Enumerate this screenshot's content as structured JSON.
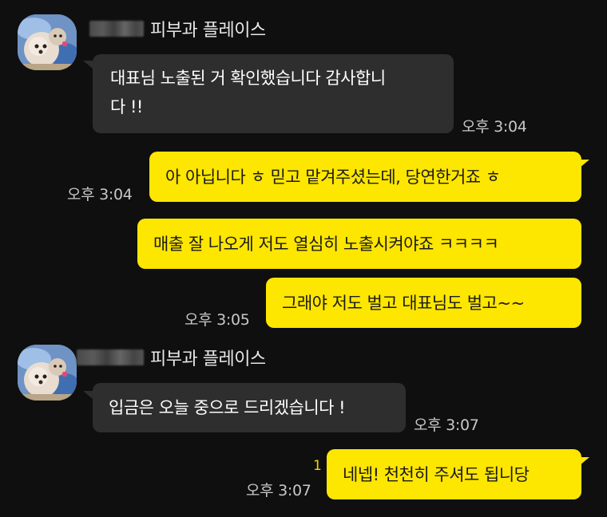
{
  "sender_name": "피부과 플레이스",
  "messages": [
    {
      "id": "m1",
      "dir": "in",
      "lines": [
        "대표님 노출된 거 확인했습니다 감사합니",
        "다 !!"
      ],
      "time": "오후 3:04"
    },
    {
      "id": "m2",
      "dir": "out",
      "text": "아 아닙니다 ㅎ 믿고 맡겨주셨는데, 당연한거죠 ㅎ",
      "time": "오후 3:04"
    },
    {
      "id": "m3",
      "dir": "out",
      "text": "매출 잘 나오게 저도 열심히 노출시켜야죠 ㅋㅋㅋㅋ",
      "time": ""
    },
    {
      "id": "m4",
      "dir": "out",
      "text": "그래야 저도 벌고 대표님도 벌고~~",
      "time": "오후 3:05"
    },
    {
      "id": "m5",
      "dir": "in",
      "text": "입금은 오늘 중으로 드리겠습니다 !",
      "time": "오후 3:07"
    },
    {
      "id": "m6",
      "dir": "out",
      "text": "네넵! 천천히 주셔도 됩니당",
      "time": "오후 3:07",
      "unread": "1"
    }
  ],
  "colors": {
    "background": "#0f0f0f",
    "incoming_bubble": "#2e2e2e",
    "outgoing_bubble": "#fde600",
    "unread": "#f5d400"
  },
  "icons": {
    "avatar": "profile-avatar-dog-photo"
  }
}
